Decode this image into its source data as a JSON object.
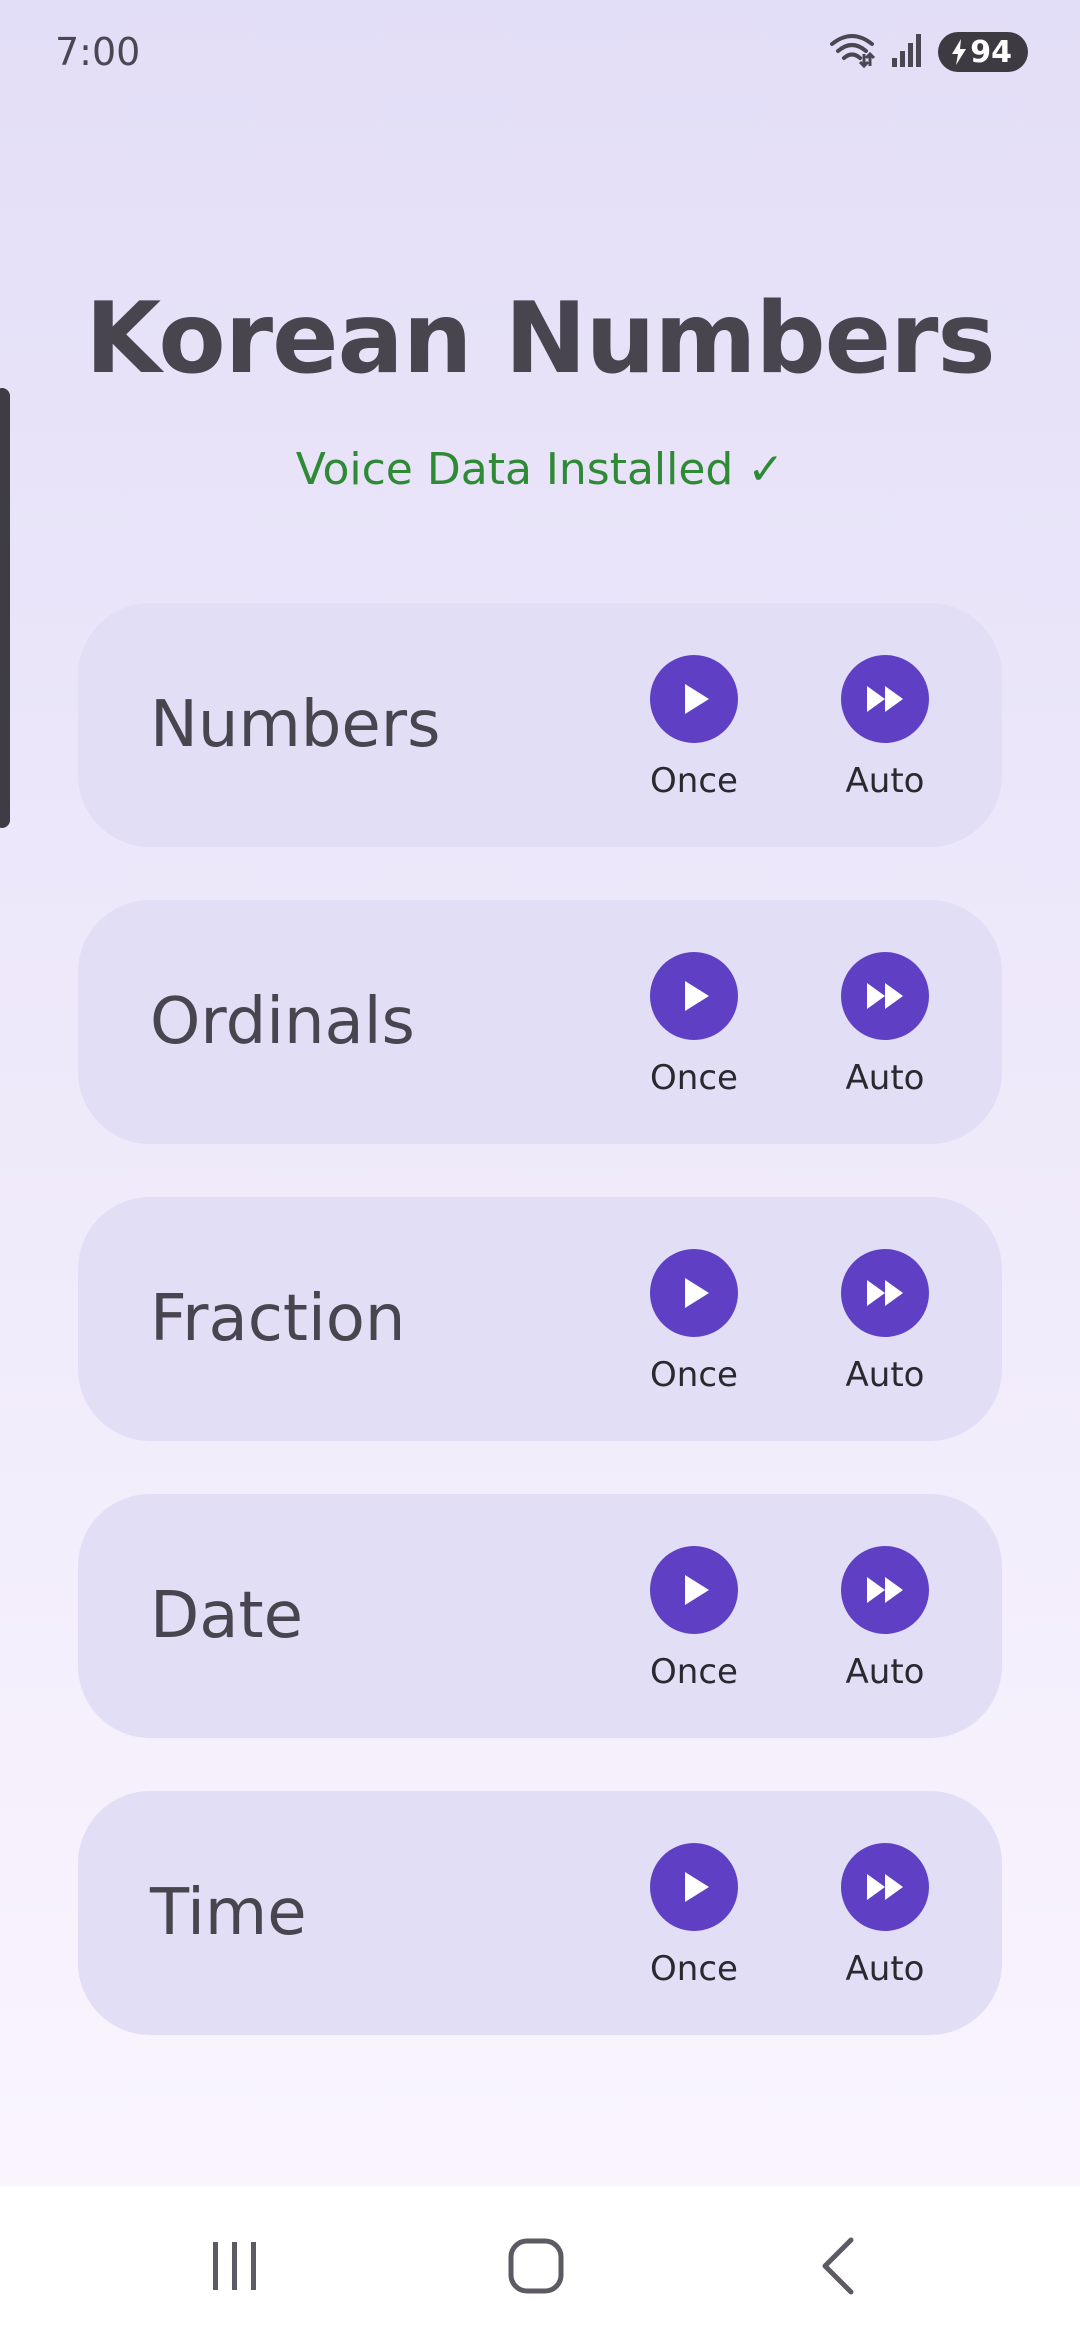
{
  "status_bar": {
    "time": "7:00",
    "battery_level": "94",
    "icons": [
      "wifi-icon",
      "signal-icon",
      "battery-charging-icon"
    ]
  },
  "header": {
    "title": "Korean Numbers",
    "voice_status": "Voice Data Installed ✓"
  },
  "colors": {
    "accent": "#5f40c5",
    "card_background": "#e2def6",
    "success_text": "#2f8a36"
  },
  "categories": [
    {
      "label": "Numbers",
      "once_label": "Once",
      "auto_label": "Auto"
    },
    {
      "label": "Ordinals",
      "once_label": "Once",
      "auto_label": "Auto"
    },
    {
      "label": "Fraction",
      "once_label": "Once",
      "auto_label": "Auto"
    },
    {
      "label": "Date",
      "once_label": "Once",
      "auto_label": "Auto"
    },
    {
      "label": "Time",
      "once_label": "Once",
      "auto_label": "Auto"
    }
  ],
  "nav_bar": {
    "icons": [
      "recents-icon",
      "home-icon",
      "back-icon"
    ]
  }
}
